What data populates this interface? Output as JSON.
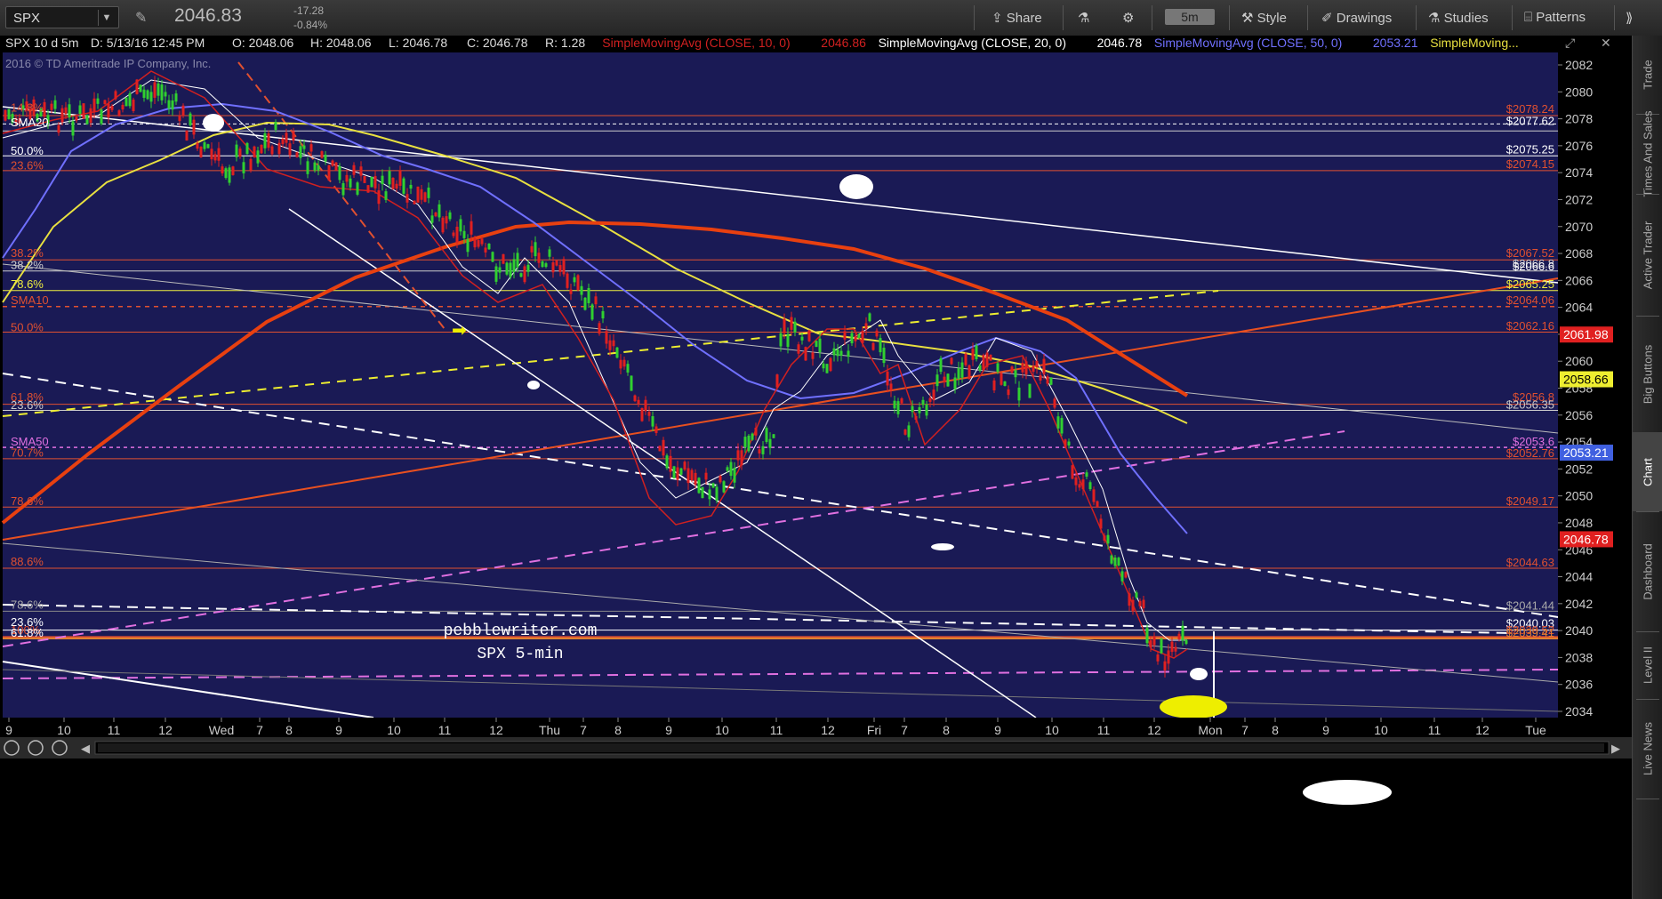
{
  "toolbar": {
    "symbol": "SPX",
    "last_price": "2046.83",
    "change_abs": "-17.28",
    "change_pct": "-0.84%",
    "share_label": "Share",
    "interval": "5m",
    "style_label": "Style",
    "drawings_label": "Drawings",
    "studies_label": "Studies",
    "patterns_label": "Patterns"
  },
  "header": {
    "desc": "SPX 10 d 5m",
    "date": "D: 5/13/16 12:45 PM",
    "open": "O: 2048.06",
    "high": "H: 2048.06",
    "low": "L: 2046.78",
    "close": "C: 2046.78",
    "range": "R: 1.28",
    "sma10_label": "SimpleMovingAvg (CLOSE, 10, 0)",
    "sma10_val": "2046.86",
    "sma20_label": "SimpleMovingAvg (CLOSE, 20, 0)",
    "sma20_val": "2046.78",
    "sma50_label": "SimpleMovingAvg (CLOSE, 50, 0)",
    "sma50_val": "2053.21",
    "sma_more": "SimpleMoving...",
    "copyright": "2016 © TD Ameritrade IP Company, Inc.",
    "watermark_site": "pebblewriter.com",
    "watermark_desc": "SPX 5-min"
  },
  "y_axis": {
    "ticks": [
      "2082",
      "2080",
      "2078",
      "2076",
      "2074",
      "2072",
      "2070",
      "2068",
      "2066",
      "2064",
      "2062",
      "2060",
      "2058",
      "2056",
      "2054",
      "2052",
      "2050",
      "2048",
      "2046",
      "2044",
      "2042",
      "2040",
      "2038",
      "2036",
      "2034"
    ]
  },
  "x_axis": {
    "ticks": [
      "9",
      "10",
      "11",
      "12",
      "Wed",
      "7",
      "8",
      "9",
      "10",
      "11",
      "12",
      "Thu",
      "7",
      "8",
      "9",
      "10",
      "11",
      "12",
      "Fri",
      "7",
      "8",
      "9",
      "10",
      "11",
      "12",
      "Mon",
      "7",
      "8",
      "9",
      "10",
      "11",
      "12",
      "Tue"
    ]
  },
  "level_labels_left": [
    {
      "text": "14.8%",
      "color": "#e05030"
    },
    {
      "text": "SMA20",
      "color": "#ffffff"
    },
    {
      "text": "50.0%",
      "color": "#ffffff"
    },
    {
      "text": "23.6%",
      "color": "#e05030"
    },
    {
      "text": "38.2%",
      "color": "#e05030"
    },
    {
      "text": "38.2%",
      "color": "#cccccc"
    },
    {
      "text": "78.6%",
      "color": "#eeee40"
    },
    {
      "text": "SMA10",
      "color": "#e05030"
    },
    {
      "text": "50.0%",
      "color": "#e05030"
    },
    {
      "text": "61.8%",
      "color": "#e05030"
    },
    {
      "text": "23.6%",
      "color": "#cccccc"
    },
    {
      "text": "SMA50",
      "color": "#e070e0"
    },
    {
      "text": "70.7%",
      "color": "#e05030"
    },
    {
      "text": "78.6%",
      "color": "#e05030"
    },
    {
      "text": "88.6%",
      "color": "#e05030"
    },
    {
      "text": "78.6%",
      "color": "#aaaaaa"
    },
    {
      "text": "23.6%",
      "color": "#ffffff"
    },
    {
      "text": "100%",
      "color": "#e05030"
    },
    {
      "text": "61.8%",
      "color": "#ffffff"
    }
  ],
  "level_labels_right": [
    {
      "text": "$2078.24",
      "color": "#e05030"
    },
    {
      "text": "$2077.62",
      "color": "#ffffff"
    },
    {
      "text": "$2075.25",
      "color": "#ffffff"
    },
    {
      "text": "$2074.15",
      "color": "#e05030"
    },
    {
      "text": "$2067.52",
      "color": "#e05030"
    },
    {
      "text": "$2066.8",
      "color": "#cccccc"
    },
    {
      "text": "$2066.6",
      "color": "#ffffff"
    },
    {
      "text": "$2065.25",
      "color": "#eeee40"
    },
    {
      "text": "$2064.06",
      "color": "#e05030"
    },
    {
      "text": "$2062.16",
      "color": "#e05030"
    },
    {
      "text": "$2056.8",
      "color": "#e05030"
    },
    {
      "text": "$2056.35",
      "color": "#cccccc"
    },
    {
      "text": "$2053.6",
      "color": "#e070e0"
    },
    {
      "text": "$2052.76",
      "color": "#e05030"
    },
    {
      "text": "$2049.17",
      "color": "#e05030"
    },
    {
      "text": "$2044.63",
      "color": "#e05030"
    },
    {
      "text": "$2041.44",
      "color": "#aaaaaa"
    },
    {
      "text": "$2040.03",
      "color": "#ffffff"
    },
    {
      "text": "$2039.52",
      "color": "#e05030"
    },
    {
      "text": "$2039.41",
      "color": "#e08030"
    }
  ],
  "price_flags": [
    {
      "text": "2061.98",
      "bg": "#e02020",
      "fg": "#ffffff"
    },
    {
      "text": "2058.66",
      "bg": "#eeee30",
      "fg": "#000000"
    },
    {
      "text": "2053.21",
      "bg": "#4060e0",
      "fg": "#ffffff"
    },
    {
      "text": "2046.78",
      "bg": "#e02020",
      "fg": "#ffffff"
    }
  ],
  "sidebar": [
    "Trade",
    "Times And Sales",
    "Active Trader",
    "Big Buttons",
    "Chart",
    "Dashboard",
    "Level II",
    "Live News"
  ],
  "colors": {
    "chart_bg": "#1a1a55",
    "sma10": "#d02020",
    "sma20": "#ffffff",
    "sma50": "#7070ff",
    "sma100": "#e8e040",
    "sma200": "#e84010",
    "fib_red": "#e05030",
    "magenta": "#e070e0"
  }
}
